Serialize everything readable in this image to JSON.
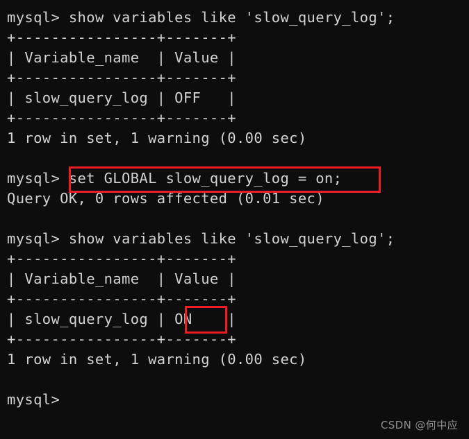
{
  "terminal": {
    "app": "mysql-client",
    "background_color": "#0d0d0d",
    "text_color": "#d2d2d2",
    "highlight_color": "#ec1c24",
    "prompt": "mysql>",
    "lines": [
      "mysql> show variables like 'slow_query_log';",
      "+----------------+-------+",
      "| Variable_name  | Value |",
      "+----------------+-------+",
      "| slow_query_log | OFF   |",
      "+----------------+-------+",
      "1 row in set, 1 warning (0.00 sec)",
      "",
      "mysql> set GLOBAL slow_query_log = on;",
      "Query OK, 0 rows affected (0.01 sec)",
      "",
      "mysql> show variables like 'slow_query_log';",
      "+----------------+-------+",
      "| Variable_name  | Value |",
      "+----------------+-------+",
      "| slow_query_log | ON    |",
      "+----------------+-------+",
      "1 row in set, 1 warning (0.00 sec)",
      "",
      "mysql>"
    ],
    "text": "mysql> show variables like 'slow_query_log';\n+----------------+-------+\n| Variable_name  | Value |\n+----------------+-------+\n| slow_query_log | OFF   |\n+----------------+-------+\n1 row in set, 1 warning (0.00 sec)\n\nmysql> set GLOBAL slow_query_log = on;\nQuery OK, 0 rows affected (0.01 sec)\n\nmysql> show variables like 'slow_query_log';\n+----------------+-------+\n| Variable_name  | Value |\n+----------------+-------+\n| slow_query_log | ON    |\n+----------------+-------+\n1 row in set, 1 warning (0.00 sec)\n\nmysql>"
  },
  "commands": {
    "first_query": "show variables like 'slow_query_log';",
    "set_statement": "set GLOBAL slow_query_log = on;",
    "second_query": "show variables like 'slow_query_log';"
  },
  "results": {
    "first_table": {
      "columns": [
        "Variable_name",
        "Value"
      ],
      "rows": [
        [
          "slow_query_log",
          "OFF"
        ]
      ],
      "status": "1 row in set, 1 warning (0.00 sec)"
    },
    "set_result": "Query OK, 0 rows affected (0.01 sec)",
    "second_table": {
      "columns": [
        "Variable_name",
        "Value"
      ],
      "rows": [
        [
          "slow_query_log",
          "ON"
        ]
      ],
      "status": "1 row in set, 1 warning (0.00 sec)"
    }
  },
  "annotations": {
    "set_global_box_target": "set GLOBAL slow_query_log = on;",
    "on_value_box_target": "ON"
  },
  "watermark": {
    "text": "CSDN @何中应"
  }
}
